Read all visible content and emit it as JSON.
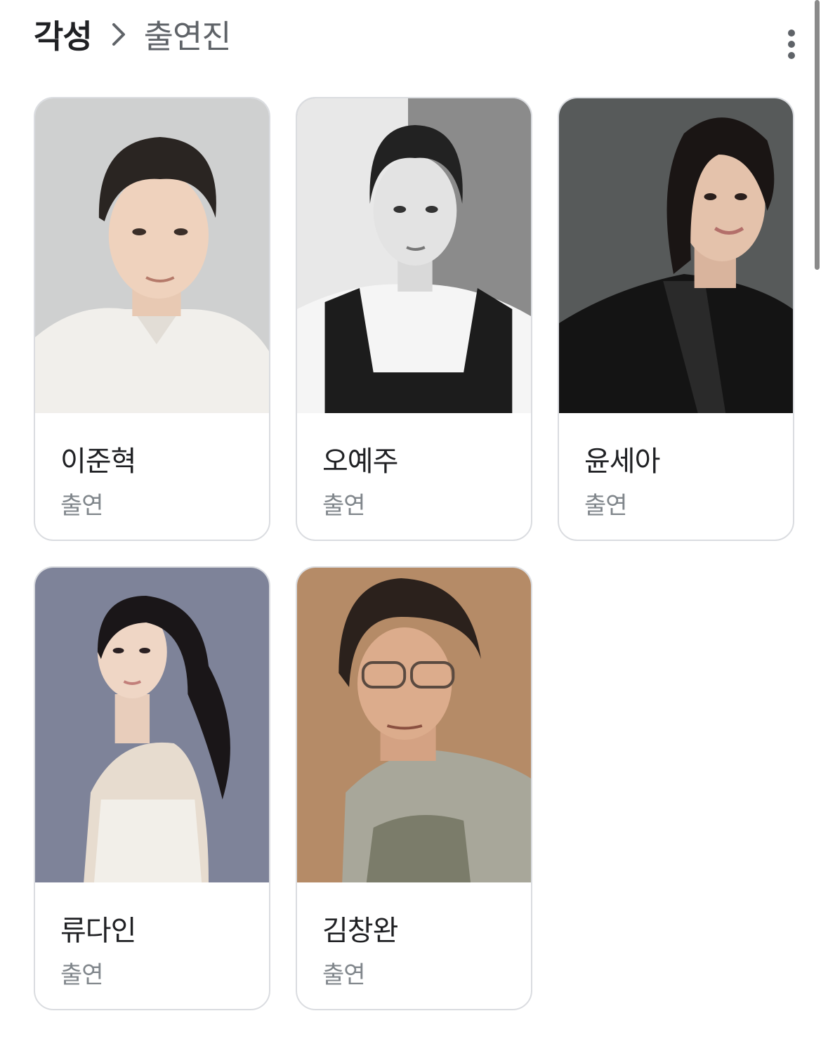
{
  "header": {
    "title": "각성",
    "separator_icon": "chevron-right-icon",
    "current": "출연진",
    "menu_icon": "more-vert-icon"
  },
  "cast": [
    {
      "name": "이준혁",
      "role": "출연",
      "photo_bg": "#cfd0d0"
    },
    {
      "name": "오예주",
      "role": "출연",
      "photo_bg": "#8e8e8e"
    },
    {
      "name": "윤세아",
      "role": "출연",
      "photo_bg": "#4a4c4c"
    },
    {
      "name": "류다인",
      "role": "출연",
      "photo_bg": "#7e8399"
    },
    {
      "name": "김창완",
      "role": "출연",
      "photo_bg": "#b58b67"
    }
  ],
  "colors": {
    "title": "#202124",
    "secondary": "#5f6368",
    "role_text": "#80868b",
    "card_border": "#dadce0"
  }
}
